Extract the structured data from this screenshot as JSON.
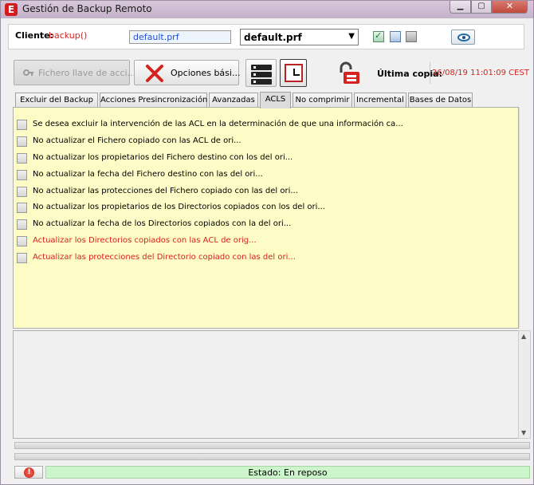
{
  "window": {
    "title": "Gestión de Backup Remoto",
    "close_label": "✕"
  },
  "header": {
    "client_label": "Cliente:",
    "client_value": "backup()",
    "profile_field": "default.prf",
    "profile_combo": "default.prf"
  },
  "toolbar": {
    "fichero_label": "Fichero llave de acci...",
    "opciones_label": "Opciones bási...",
    "ultima_copia_label": "Última copia:",
    "ultima_copia_value": "26/08/19 11:01:09 CEST"
  },
  "tabs": [
    {
      "label": "Excluir del Backup",
      "active": false
    },
    {
      "label": "Acciones Presincronización",
      "active": false
    },
    {
      "label": "Avanzadas",
      "active": false
    },
    {
      "label": "ACLS",
      "active": true
    },
    {
      "label": "No comprimir",
      "active": false
    },
    {
      "label": "Incremental",
      "active": false
    },
    {
      "label": "Bases de Datos",
      "active": false
    }
  ],
  "options": [
    {
      "label": "Se desea excluir la intervención de las ACL en la determinación de que una información ca...",
      "red": false
    },
    {
      "label": "No actualizar el Fichero copiado con las ACL de ori...",
      "red": false
    },
    {
      "label": "No actualizar los propietarios del Fichero destino con los del ori...",
      "red": false
    },
    {
      "label": "No actualizar la fecha del Fichero destino con las del ori...",
      "red": false
    },
    {
      "label": "No actualizar las protecciones del Fichero copiado con las del ori...",
      "red": false
    },
    {
      "label": "No actualizar los propietarios de los Directorios copiados con los del ori...",
      "red": false
    },
    {
      "label": "No actualizar la fecha de los Directorios copiados con la del ori...",
      "red": false
    },
    {
      "label": "Actualizar los Directorios copiados con las ACL de orig...",
      "red": true
    },
    {
      "label": "Actualizar las protecciones del Directorio copiado con las del ori...",
      "red": true
    }
  ],
  "status": {
    "text": "Estado: En reposo",
    "stop_glyph": "!"
  },
  "progress": {
    "fraction": 0
  },
  "colors": {
    "accent_red": "#d4231e",
    "panel_yellow": "#fefcc6",
    "status_green": "#ccf5cc"
  }
}
